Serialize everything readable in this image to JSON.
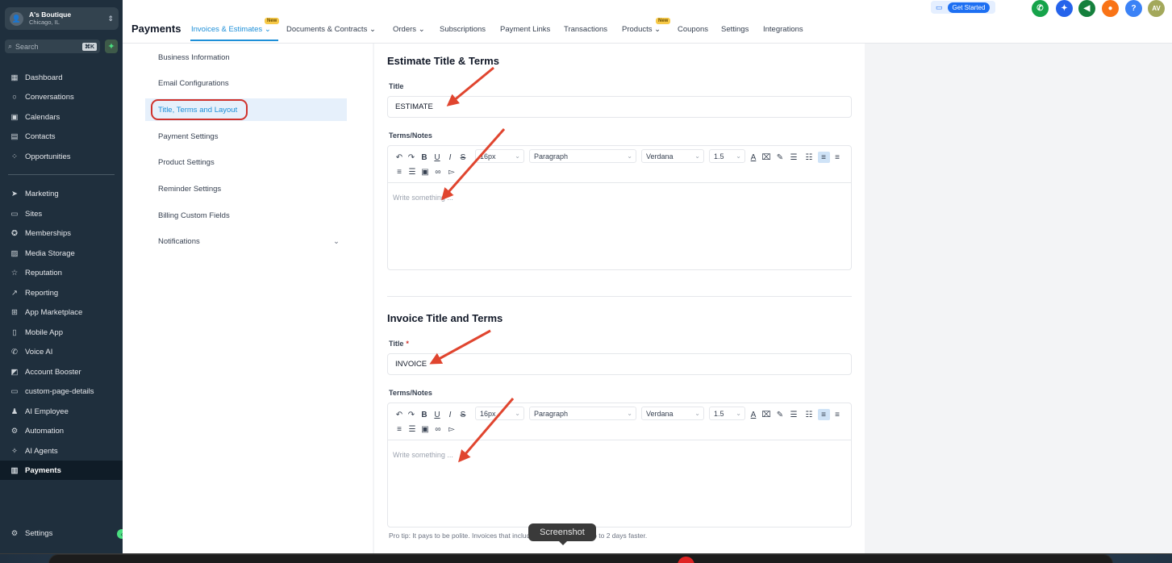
{
  "sidebar": {
    "location": {
      "name": "A's Boutique",
      "city": "Chicago, IL",
      "avatar": "👤"
    },
    "search": {
      "placeholder": "Search",
      "shortcut": "⌘K"
    },
    "items": [
      {
        "label": "Dashboard",
        "icon": "dashboard-icon"
      },
      {
        "label": "Conversations",
        "icon": "chat-icon"
      },
      {
        "label": "Calendars",
        "icon": "calendar-icon"
      },
      {
        "label": "Contacts",
        "icon": "contacts-icon"
      },
      {
        "label": "Opportunities",
        "icon": "opportunities-icon"
      },
      {
        "label": "Marketing",
        "icon": "send-icon"
      },
      {
        "label": "Sites",
        "icon": "sites-icon"
      },
      {
        "label": "Memberships",
        "icon": "award-icon"
      },
      {
        "label": "Media Storage",
        "icon": "image-icon"
      },
      {
        "label": "Reputation",
        "icon": "star-icon"
      },
      {
        "label": "Reporting",
        "icon": "trend-icon"
      },
      {
        "label": "App Marketplace",
        "icon": "grid-icon"
      },
      {
        "label": "Mobile App",
        "icon": "phone-icon"
      },
      {
        "label": "Voice AI",
        "icon": "voice-icon"
      },
      {
        "label": "Account Booster",
        "icon": "booster-icon"
      },
      {
        "label": "custom-page-details",
        "icon": "page-icon"
      },
      {
        "label": "AI Employee",
        "icon": "person-icon"
      },
      {
        "label": "Automation",
        "icon": "automation-icon"
      },
      {
        "label": "AI Agents",
        "icon": "sparkle-icon"
      },
      {
        "label": "Payments",
        "icon": "receipt-icon"
      }
    ],
    "settings": "Settings",
    "active": "Payments"
  },
  "header": {
    "title": "Payments",
    "tabs": [
      {
        "label": "Invoices & Estimates",
        "active": true,
        "dropdown": true,
        "badge": "New"
      },
      {
        "label": "Documents & Contracts",
        "dropdown": true
      },
      {
        "label": "Orders",
        "dropdown": true
      },
      {
        "label": "Subscriptions"
      },
      {
        "label": "Payment Links"
      },
      {
        "label": "Transactions"
      },
      {
        "label": "Products",
        "dropdown": true,
        "badge": "New"
      },
      {
        "label": "Coupons"
      },
      {
        "label": "Settings"
      },
      {
        "label": "Integrations"
      }
    ],
    "get_started": "Get Started",
    "user_initials": "AV",
    "help": "?"
  },
  "settings_menu": {
    "items": [
      "Business Information",
      "Email Configurations",
      "Title, Terms and Layout",
      "Payment Settings",
      "Product Settings",
      "Reminder Settings",
      "Billing Custom Fields",
      "Notifications"
    ],
    "active": "Title, Terms and Layout"
  },
  "estimate": {
    "heading": "Estimate Title & Terms",
    "title_label": "Title",
    "title_value": "ESTIMATE",
    "terms_label": "Terms/Notes",
    "placeholder": "Write something ..."
  },
  "invoice": {
    "heading": "Invoice Title and Terms",
    "title_label": "Title",
    "required_mark": "*",
    "title_value": "INVOICE",
    "terms_label": "Terms/Notes",
    "placeholder": "Write something ..."
  },
  "toolbar": {
    "font_size": "16px",
    "block": "Paragraph",
    "font": "Verdana",
    "line_height": "1.5"
  },
  "tip": "Pro tip: It pays to be polite. Invoices that include \"thanks\" get paid up to 2 days faster.",
  "overlay": {
    "screenshot_tooltip": "Screenshot"
  },
  "colors": {
    "sidebar": "#1f2f3d",
    "accent": "#1d8fd8",
    "annotation": "#e0452f"
  }
}
